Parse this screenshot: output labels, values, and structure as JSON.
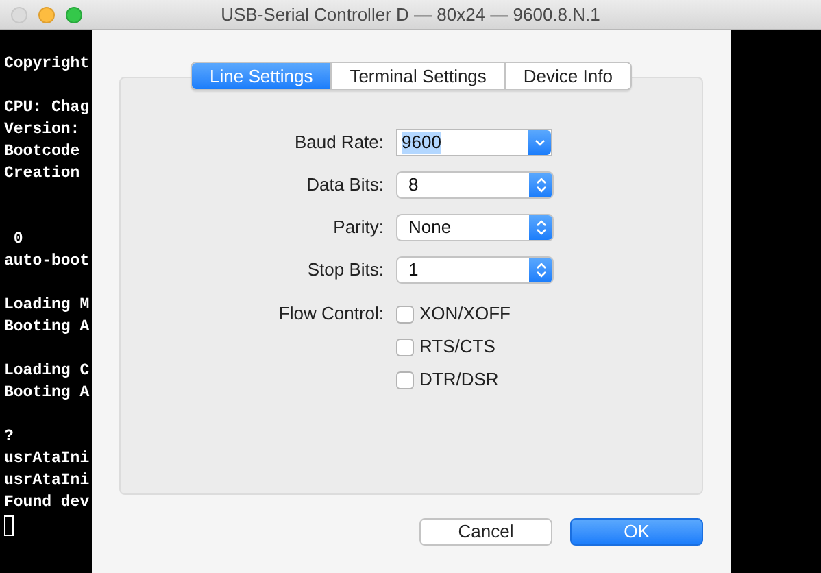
{
  "window": {
    "title": "USB-Serial Controller D — 80x24 — 9600.8.N.1"
  },
  "terminal": {
    "blocks": [
      {
        "lines": [
          "Copyright"
        ]
      },
      {
        "kind": "single",
        "lines": [
          "CPU: Chag",
          "Version:",
          "Bootcode",
          "Creation"
        ]
      },
      {
        "kind": "double",
        "lines": [
          " 0",
          "auto-boot"
        ]
      },
      {
        "kind": "single",
        "lines": [
          "Loading M",
          "Booting A"
        ]
      },
      {
        "kind": "single",
        "lines": [
          "Loading C",
          "Booting A"
        ]
      },
      {
        "kind": "single",
        "lines": [
          "?",
          "usrAtaIni",
          "usrAtaIni",
          "Found dev"
        ]
      }
    ]
  },
  "tabs": [
    {
      "label": "Line Settings",
      "selected": true
    },
    {
      "label": "Terminal Settings",
      "selected": false
    },
    {
      "label": "Device Info",
      "selected": false
    }
  ],
  "fields": [
    {
      "label": "Baud Rate:",
      "kind": "combo",
      "value": "9600",
      "highlighted": true
    },
    {
      "label": "Data Bits:",
      "kind": "popup",
      "value": "8"
    },
    {
      "label": "Parity:",
      "kind": "popup",
      "value": "None"
    },
    {
      "label": "Stop Bits:",
      "kind": "popup",
      "value": "1"
    }
  ],
  "flow_control": {
    "label": "Flow Control:",
    "options": [
      {
        "label": "XON/XOFF",
        "checked": false
      },
      {
        "label": "RTS/CTS",
        "checked": false
      },
      {
        "label": "DTR/DSR",
        "checked": false
      }
    ]
  },
  "buttons": [
    {
      "label": "Cancel",
      "kind": "secondary"
    },
    {
      "label": "OK",
      "kind": "primary"
    }
  ]
}
